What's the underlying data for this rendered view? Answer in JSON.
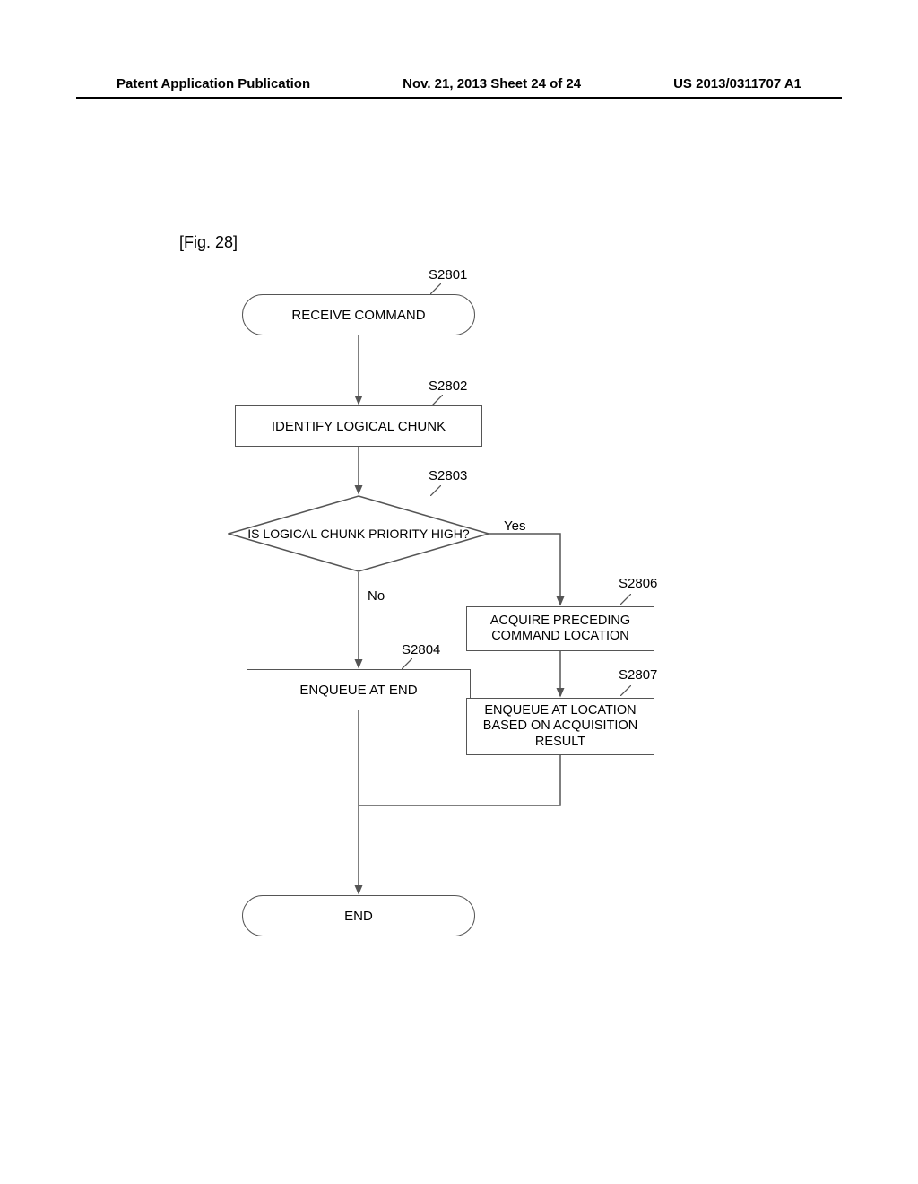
{
  "header": {
    "left": "Patent Application Publication",
    "center": "Nov. 21, 2013  Sheet 24 of 24",
    "right": "US 2013/0311707 A1"
  },
  "figure_label": "[Fig. 28]",
  "steps": {
    "s2801": {
      "label": "S2801",
      "text": "RECEIVE COMMAND"
    },
    "s2802": {
      "label": "S2802",
      "text": "IDENTIFY LOGICAL CHUNK"
    },
    "s2803": {
      "label": "S2803",
      "text": "IS LOGICAL CHUNK PRIORITY HIGH?"
    },
    "s2804": {
      "label": "S2804",
      "text": "ENQUEUE AT END"
    },
    "s2806": {
      "label": "S2806",
      "text": "ACQUIRE PRECEDING COMMAND LOCATION"
    },
    "s2807": {
      "label": "S2807",
      "text": "ENQUEUE AT LOCATION BASED ON ACQUISITION RESULT"
    },
    "end": {
      "text": "END"
    }
  },
  "branches": {
    "yes": "Yes",
    "no": "No"
  },
  "chart_data": {
    "type": "flowchart",
    "title": "Fig. 28",
    "nodes": [
      {
        "id": "S2801",
        "type": "terminal",
        "text": "RECEIVE COMMAND"
      },
      {
        "id": "S2802",
        "type": "process",
        "text": "IDENTIFY LOGICAL CHUNK"
      },
      {
        "id": "S2803",
        "type": "decision",
        "text": "IS LOGICAL CHUNK PRIORITY HIGH?"
      },
      {
        "id": "S2804",
        "type": "process",
        "text": "ENQUEUE AT END"
      },
      {
        "id": "S2806",
        "type": "process",
        "text": "ACQUIRE PRECEDING COMMAND LOCATION"
      },
      {
        "id": "S2807",
        "type": "process",
        "text": "ENQUEUE AT LOCATION BASED ON ACQUISITION RESULT"
      },
      {
        "id": "END",
        "type": "terminal",
        "text": "END"
      }
    ],
    "edges": [
      {
        "from": "S2801",
        "to": "S2802"
      },
      {
        "from": "S2802",
        "to": "S2803"
      },
      {
        "from": "S2803",
        "to": "S2806",
        "label": "Yes"
      },
      {
        "from": "S2803",
        "to": "S2804",
        "label": "No"
      },
      {
        "from": "S2806",
        "to": "S2807"
      },
      {
        "from": "S2804",
        "to": "END"
      },
      {
        "from": "S2807",
        "to": "END"
      }
    ]
  }
}
